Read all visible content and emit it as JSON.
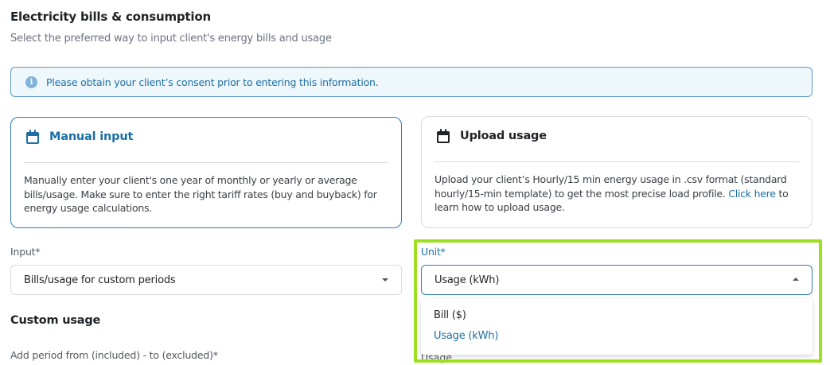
{
  "header": {
    "title": "Electricity bills & consumption",
    "subtitle": "Select the preferred way to input client's energy bills and usage"
  },
  "banner": {
    "icon": "info-icon",
    "icon_glyph": "i",
    "text": "Please obtain your client’s consent prior to entering this information."
  },
  "cards": {
    "manual": {
      "icon": "calendar-icon",
      "title": "Manual input",
      "description": "Manually enter your client's one year of monthly or yearly or average bills/usage. Make sure to enter the right tariff rates (buy and buyback) for energy usage calculations."
    },
    "upload": {
      "icon": "calendar-icon",
      "title": "Upload usage",
      "description_before": "Upload your client’s Hourly/15 min energy usage in .csv format (standard hourly/15-min template) to get the most precise load profile. ",
      "link_text": "Click here",
      "description_after": " to learn how to upload usage."
    }
  },
  "fields": {
    "input_label": "Input*",
    "input_value": "Bills/usage for custom periods",
    "unit_label": "Unit*",
    "unit_value": "Usage (kWh)",
    "unit_options": [
      "Bill ($)",
      "Usage (kWh)"
    ]
  },
  "custom_usage": {
    "title": "Custom usage",
    "period_label": "Add period from (included) - to (excluded)*",
    "usage_label": "Usage"
  },
  "colors": {
    "accent": "#1d6fa5",
    "highlight": "#9ee020",
    "banner_bg": "#eef7fc"
  }
}
